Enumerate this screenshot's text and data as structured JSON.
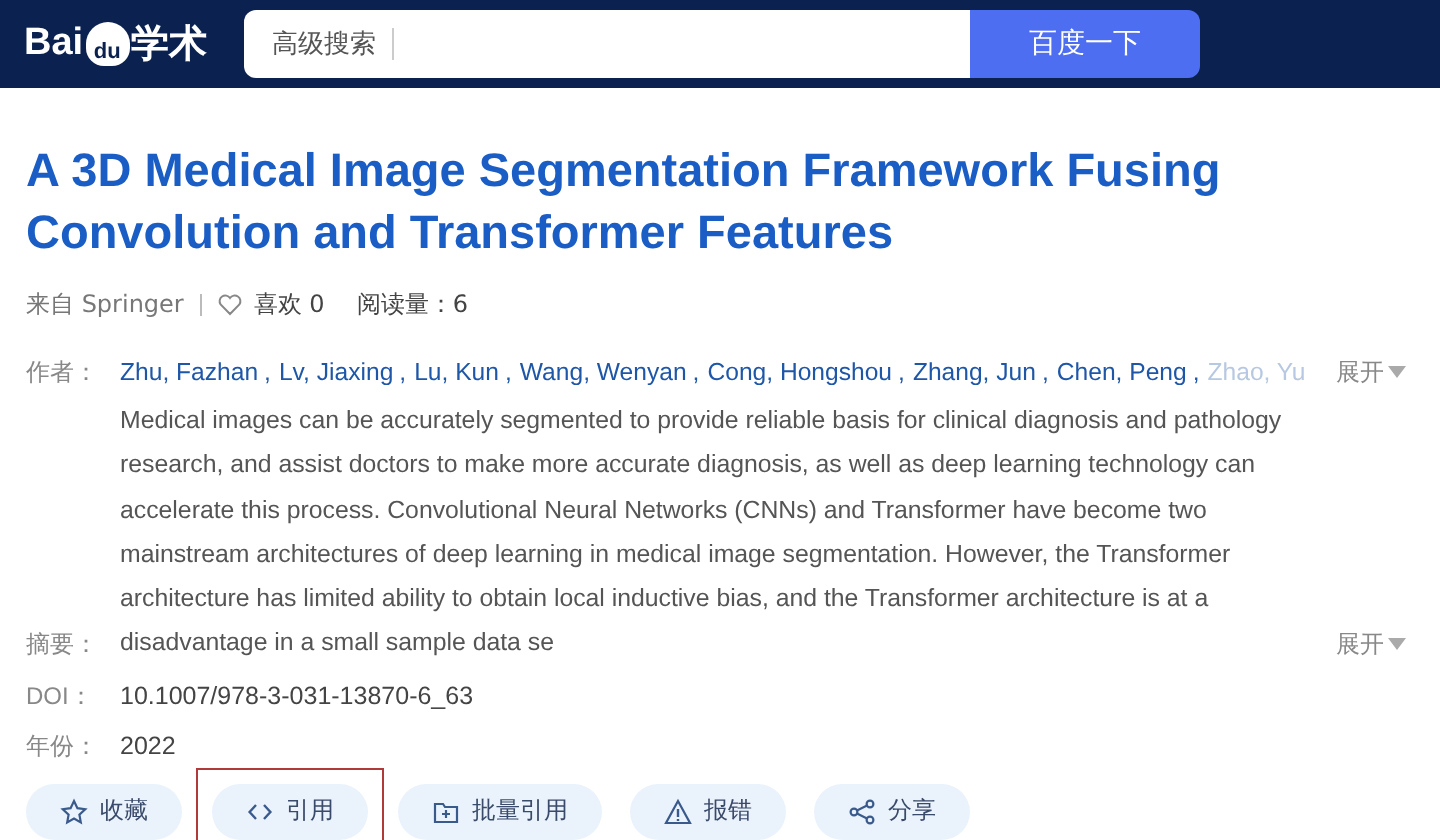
{
  "header": {
    "logo": {
      "left": "Bai",
      "paw": "du",
      "right": "学术"
    },
    "search": {
      "link": "高级搜索"
    },
    "search_button": "百度一下"
  },
  "paper": {
    "title": "A 3D Medical Image Segmentation Framework Fusing Convolution and Transformer Features",
    "source": "来自 Springer",
    "likes": "喜欢 0",
    "reads": "阅读量：6",
    "authors_label": "作者：",
    "author_separator": ",",
    "authors": [
      "Zhu, Fazhan",
      "Lv, Jiaxing",
      "Lu, Kun",
      "Wang, Wenyan",
      "Cong, Hongshou",
      "Zhang, Jun",
      "Chen, Peng",
      "Zhao, Yu"
    ],
    "expand": "展开",
    "abstract_label": "摘要：",
    "abstract": "Medical images can be accurately segmented to provide reliable basis for clinical diagnosis and pathology research, and assist doctors to make more accurate diagnosis, as well as deep learning technology can accelerate this process. Convolutional Neural Networks (CNNs) and Transformer have become two mainstream architectures of deep learning in medical image segmentation. However, the Transformer architecture has limited ability to obtain local inductive bias, and the Transformer architecture is at a disadvantage in a small sample data se",
    "abstract_expand": "展开",
    "doi_label": "DOI：",
    "doi": "10.1007/978-3-031-13870-6_63",
    "year_label": "年份：",
    "year": "2022"
  },
  "actions": [
    {
      "kind": "star",
      "label": "收藏",
      "highlighted": false
    },
    {
      "kind": "code",
      "label": "引用",
      "highlighted": true
    },
    {
      "kind": "folder",
      "label": "批量引用",
      "highlighted": false
    },
    {
      "kind": "warning",
      "label": "报错",
      "highlighted": false
    },
    {
      "kind": "share",
      "label": "分享",
      "highlighted": false
    }
  ]
}
